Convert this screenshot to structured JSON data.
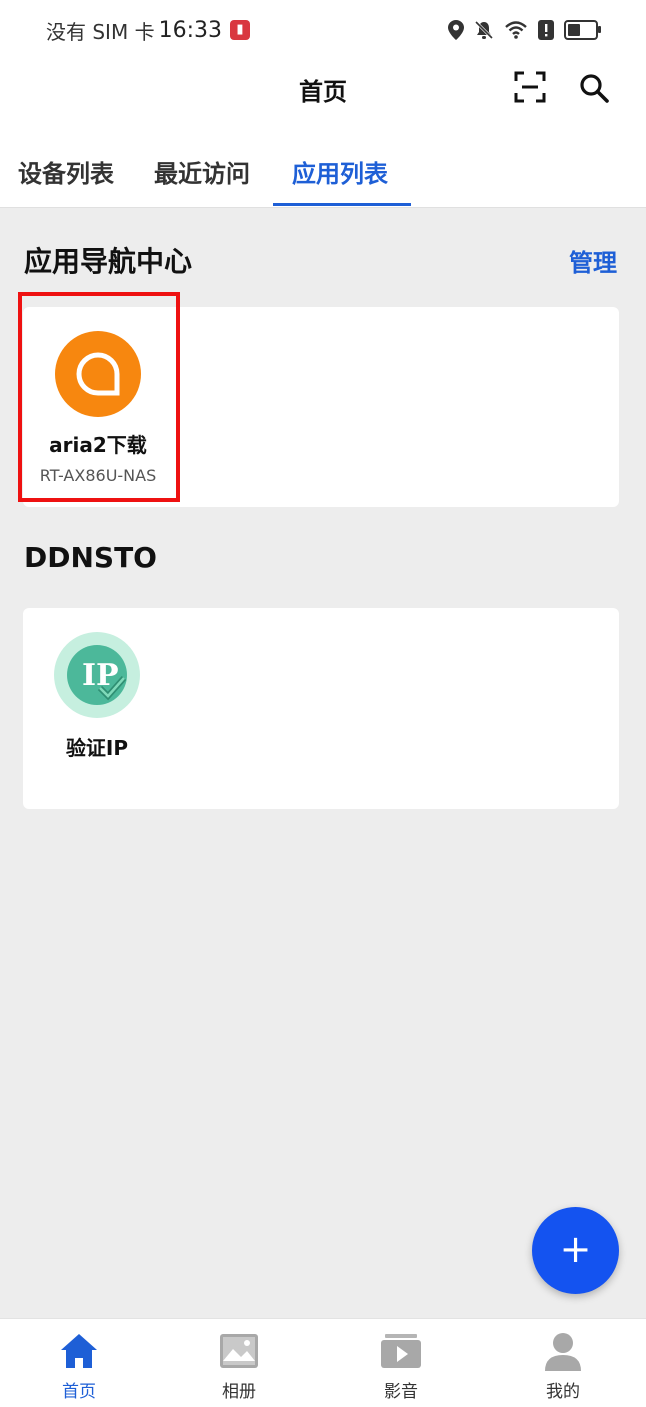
{
  "status_bar": {
    "carrier": "没有 SIM 卡",
    "time": "16:33"
  },
  "header": {
    "title": "首页",
    "scan_icon": "scan-icon",
    "search_icon": "search-icon"
  },
  "tabs": [
    {
      "label": "设备列表",
      "active": false
    },
    {
      "label": "最近访问",
      "active": false
    },
    {
      "label": "应用列表",
      "active": true
    }
  ],
  "section1": {
    "title": "应用导航中心",
    "manage_label": "管理",
    "apps": [
      {
        "name": "aria2下载",
        "device": "RT-AX86U-NAS",
        "icon": "aria2-icon",
        "color": "#f7870f"
      }
    ]
  },
  "section2": {
    "title": "DDNSTO",
    "apps": [
      {
        "name": "验证IP",
        "icon": "ip-verify-icon",
        "color": "#4cb89a"
      }
    ]
  },
  "fab": {
    "label": "+"
  },
  "bottom_nav": [
    {
      "label": "首页",
      "icon": "home-icon",
      "active": true
    },
    {
      "label": "相册",
      "icon": "album-icon",
      "active": false
    },
    {
      "label": "影音",
      "icon": "media-icon",
      "active": false
    },
    {
      "label": "我的",
      "icon": "profile-icon",
      "active": false
    }
  ],
  "colors": {
    "accent": "#1e5fd6",
    "fab": "#1453f0",
    "highlight": "#ee1111"
  }
}
